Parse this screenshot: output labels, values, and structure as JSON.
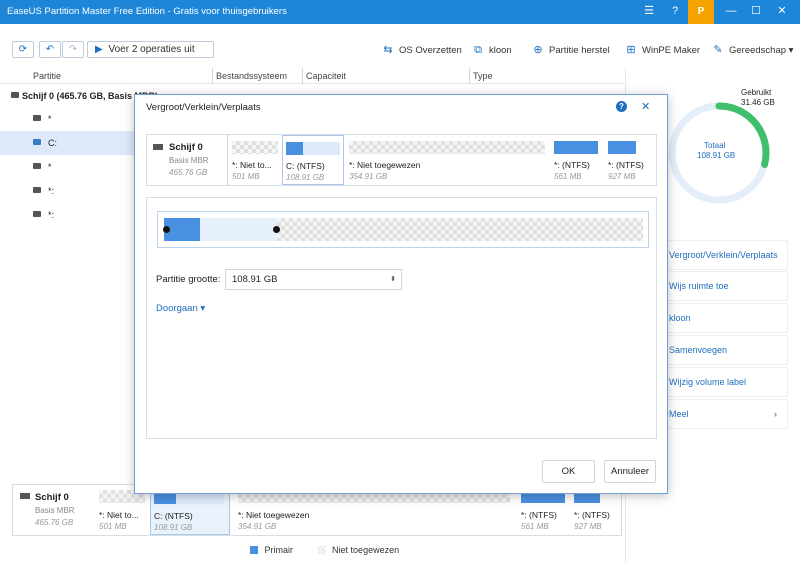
{
  "app": {
    "title": "EaseUS Partition Master Free Edition - Gratis voor thuisgebruikers",
    "promo_label": "P"
  },
  "toolbar": {
    "apply_label": "Voer 2 operaties uit",
    "tools": [
      "OS Overzetten",
      "kloon",
      "Partitie herstel",
      "WinPE Maker",
      "Gereedschap"
    ]
  },
  "columns": {
    "partition": "Partitie",
    "filesystem": "Bestandssysteem",
    "capacity": "Capaciteit",
    "type": "Type"
  },
  "tree": {
    "disk_label": "Schijf 0 (465.76 GB, Basis MBR)",
    "rows": [
      "*",
      "C:",
      "*",
      "*:",
      "*:"
    ]
  },
  "usage": {
    "used_label": "Gebruikt",
    "used_value": "31.46 GB",
    "total_label": "Totaal",
    "total_value": "108.91 GB",
    "used_fraction": 0.289
  },
  "operations": [
    "Vergroot/Verklein/Verplaats",
    "Wijs ruimte toe",
    "kloon",
    "Samenvoegen",
    "Wijzig volume label",
    "Meel"
  ],
  "disk_summary": {
    "name": "Schijf 0",
    "type": "Basis MBR",
    "size": "465.76 GB"
  },
  "partitions": [
    {
      "label": "*: Niet toegewezen",
      "short": "*: Niet to...",
      "size": "501 MB",
      "kind": "unallocated"
    },
    {
      "label": "C: (NTFS)",
      "size": "108.91 GB",
      "kind": "primary"
    },
    {
      "label": "*: Niet toegewezen",
      "size": "354.91 GB",
      "kind": "unallocated"
    },
    {
      "label": "*: (NTFS)",
      "size": "561 MB",
      "kind": "primary"
    },
    {
      "label": "*: (NTFS)",
      "size": "927 MB",
      "kind": "primary"
    }
  ],
  "legend": {
    "primary": "Primair",
    "unallocated": "Niet toegewezen"
  },
  "dialog": {
    "title": "Vergroot/Verklein/Verplaats",
    "size_label": "Partitie grootte:",
    "size_value": "108.91 GB",
    "advanced_label": "Doorgaan",
    "ok_label": "OK",
    "cancel_label": "Annuleer",
    "help_icon": "?",
    "close_icon": "✕"
  }
}
